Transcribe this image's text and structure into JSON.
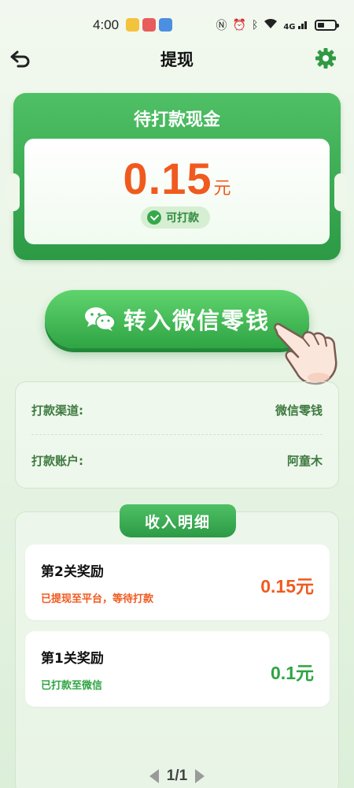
{
  "status_bar": {
    "time": "4:00",
    "network_label": "4G",
    "app_icon_colors": [
      "#f4c33d",
      "#e85c5c",
      "#4b8fe0"
    ]
  },
  "nav": {
    "title": "提现",
    "back_icon": "back-arrow-icon",
    "settings_icon": "gear-icon"
  },
  "cash_card": {
    "title": "待打款现金",
    "amount": "0.15",
    "unit": "元",
    "status_label": "可打款"
  },
  "wechat_button": {
    "label": "转入微信零钱",
    "icon": "wechat-icon"
  },
  "payout_info": {
    "channel_label": "打款渠道:",
    "channel_value": "微信零钱",
    "account_label": "打款账户:",
    "account_value": "阿童木"
  },
  "income": {
    "tab_title": "收入明细",
    "records": [
      {
        "title": "第2关奖励",
        "status": "已提现至平台，等待打款",
        "amount": "0.15元",
        "status_color": "#f05a1e",
        "amount_color": "#f05a1e"
      },
      {
        "title": "第1关奖励",
        "status": "已打款至微信",
        "amount": "0.1元",
        "status_color": "#2fa443",
        "amount_color": "#2fa443"
      }
    ]
  },
  "pager": {
    "text": "1/1"
  },
  "colors": {
    "brand_green": "#2c9a45",
    "accent_orange": "#f05a1e"
  }
}
